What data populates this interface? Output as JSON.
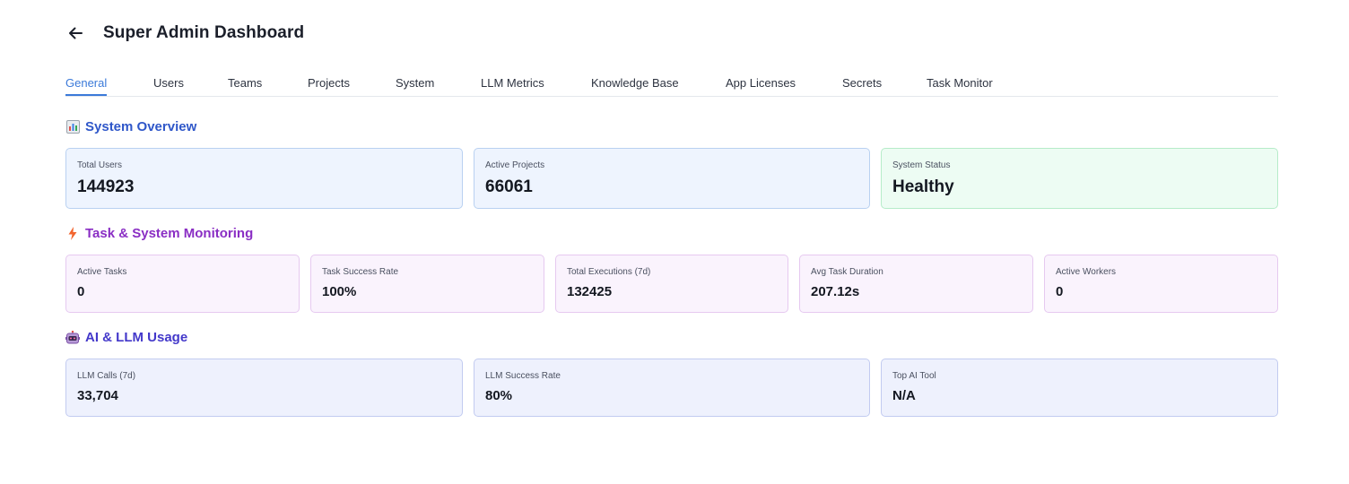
{
  "header": {
    "title": "Super Admin Dashboard",
    "back_icon": "arrow-left-icon"
  },
  "tabs": [
    {
      "label": "General",
      "active": true
    },
    {
      "label": "Users"
    },
    {
      "label": "Teams"
    },
    {
      "label": "Projects"
    },
    {
      "label": "System"
    },
    {
      "label": "LLM Metrics"
    },
    {
      "label": "Knowledge Base"
    },
    {
      "label": "App Licenses"
    },
    {
      "label": "Secrets"
    },
    {
      "label": "Task Monitor"
    }
  ],
  "overview": {
    "title": "System Overview",
    "icon": "bar-chart-icon",
    "color": "#2f57c9",
    "cards": [
      {
        "label": "Total Users",
        "value": "144923"
      },
      {
        "label": "Active Projects",
        "value": "66061"
      },
      {
        "label": "System Status",
        "value": "Healthy"
      }
    ]
  },
  "monitoring": {
    "title": "Task & System Monitoring",
    "icon": "lightning-icon",
    "color": "#8a2ec4",
    "cards": [
      {
        "label": "Active Tasks",
        "value": "0"
      },
      {
        "label": "Task Success Rate",
        "value": "100%"
      },
      {
        "label": "Total Executions (7d)",
        "value": "132425"
      },
      {
        "label": "Avg Task Duration",
        "value": "207.12s"
      },
      {
        "label": "Active Workers",
        "value": "0"
      }
    ]
  },
  "ai_usage": {
    "title": "AI & LLM Usage",
    "icon": "robot-icon",
    "color": "#4338ca",
    "cards": [
      {
        "label": "LLM Calls (7d)",
        "value": "33,704"
      },
      {
        "label": "LLM Success Rate",
        "value": "80%"
      },
      {
        "label": "Top AI Tool",
        "value": "N/A"
      }
    ]
  }
}
